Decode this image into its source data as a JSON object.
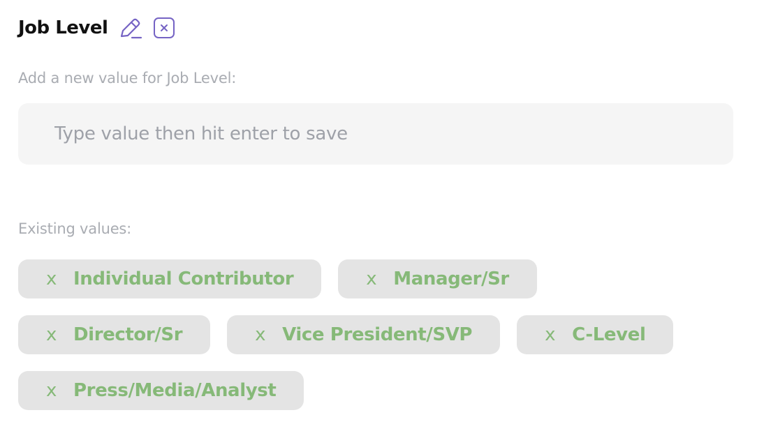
{
  "header": {
    "title": "Job Level",
    "edit_icon": "pencil-icon",
    "close_icon": "close-icon",
    "accent_color": "#7563c4"
  },
  "add_value": {
    "label": "Add a new value for Job Level:",
    "placeholder": "Type value then hit enter to save",
    "value": ""
  },
  "existing": {
    "label": "Existing values:",
    "remove_glyph": "x",
    "chip_text_color": "#86b978",
    "values": [
      "Individual Contributor",
      "Manager/Sr",
      "Director/Sr",
      "Vice President/SVP",
      "C-Level",
      "Press/Media/Analyst"
    ]
  }
}
